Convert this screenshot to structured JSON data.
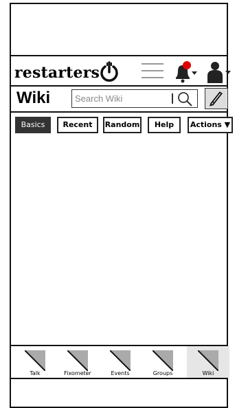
{
  "brand": {
    "logo_text": "restarters"
  },
  "header": {
    "menu_icon": "hamburger-icon",
    "notification_icon": "bell-icon",
    "notification_badge_color": "#e00000",
    "user_icon": "user-icon"
  },
  "wiki": {
    "title": "Wiki",
    "search": {
      "placeholder": "Search Wiki",
      "value": ""
    },
    "edit_icon": "pencil-icon"
  },
  "tabs": [
    {
      "label": "Basics",
      "active": true
    },
    {
      "label": "Recent",
      "active": false
    },
    {
      "label": "Random",
      "active": false
    },
    {
      "label": "Help",
      "active": false
    },
    {
      "label": "Actions ▼",
      "active": false
    }
  ],
  "bottom_nav": [
    {
      "label": "Talk",
      "active": false
    },
    {
      "label": "Fixometer",
      "active": false
    },
    {
      "label": "Events",
      "active": false
    },
    {
      "label": "Groups",
      "active": false
    },
    {
      "label": "Wiki",
      "active": true
    }
  ]
}
